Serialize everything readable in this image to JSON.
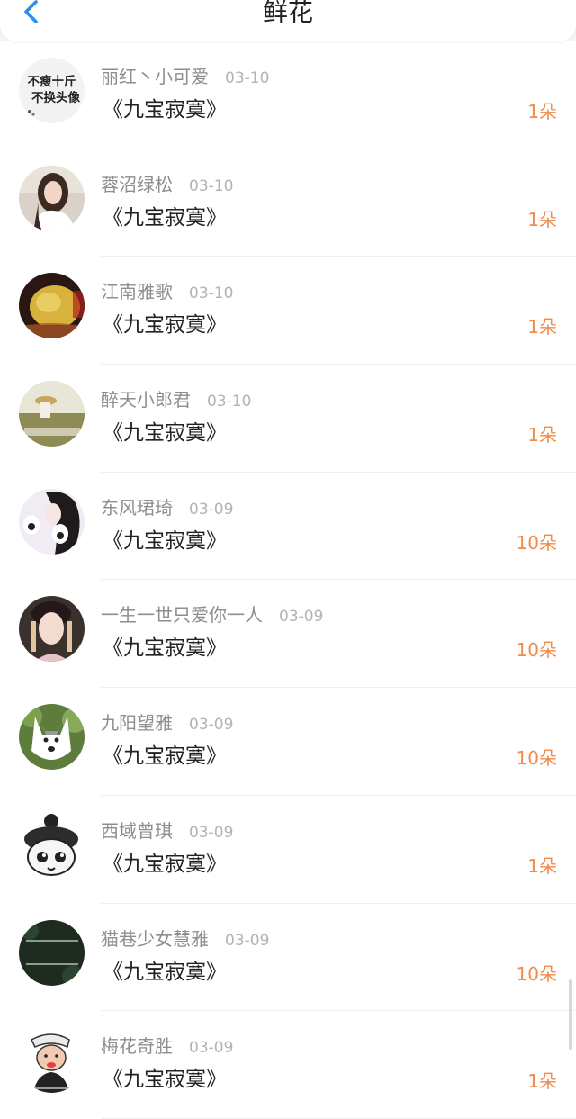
{
  "header": {
    "title": "鲜花",
    "back_icon": "chevron-left-icon",
    "accent_color": "#2d8cf0"
  },
  "colors": {
    "name": "#8e8e8e",
    "date": "#b3b3b3",
    "gift": "#222222",
    "amount": "#f28a48"
  },
  "avatar_badge_text": {
    "line1": "不瘦十斤",
    "line2": "不换头像"
  },
  "rows": [
    {
      "name": "丽红丶小可爱",
      "date": "03-10",
      "gift": "《九宝寂寞》",
      "amount": "1朵"
    },
    {
      "name": "蓉沼绿松",
      "date": "03-10",
      "gift": "《九宝寂寞》",
      "amount": "1朵"
    },
    {
      "name": "江南雅歌",
      "date": "03-10",
      "gift": "《九宝寂寞》",
      "amount": "1朵"
    },
    {
      "name": "醉天小郎君",
      "date": "03-10",
      "gift": "《九宝寂寞》",
      "amount": "1朵"
    },
    {
      "name": "东风珺琦",
      "date": "03-09",
      "gift": "《九宝寂寞》",
      "amount": "10朵"
    },
    {
      "name": "一生一世只爱你一人",
      "date": "03-09",
      "gift": "《九宝寂寞》",
      "amount": "10朵"
    },
    {
      "name": "九阳望雅",
      "date": "03-09",
      "gift": "《九宝寂寞》",
      "amount": "10朵"
    },
    {
      "name": "西域曾琪",
      "date": "03-09",
      "gift": "《九宝寂寞》",
      "amount": "1朵"
    },
    {
      "name": "猫巷少女慧雅",
      "date": "03-09",
      "gift": "《九宝寂寞》",
      "amount": "10朵"
    },
    {
      "name": "梅花奇胜",
      "date": "03-09",
      "gift": "《九宝寂寞》",
      "amount": "1朵"
    }
  ]
}
